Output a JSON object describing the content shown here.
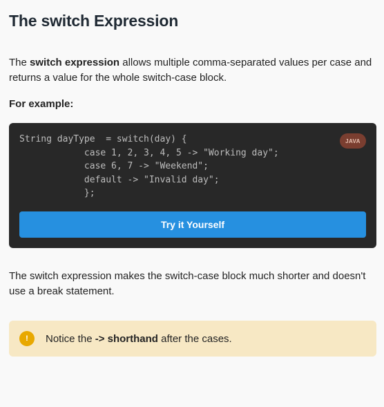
{
  "heading": {
    "title": "The switch Expression"
  },
  "intro": {
    "before": "The ",
    "bold": "switch expression",
    "after": " allows multiple comma-separated values per case and returns a value for the whole switch-case block."
  },
  "example": {
    "label": "For example:",
    "language_badge": "JAVA",
    "code_lines": [
      "String dayType  = switch(day) {",
      "            case 1, 2, 3, 4, 5 -> \"Working day\";",
      "            case 6, 7 -> \"Weekend\";",
      "            default -> \"Invalid day\";",
      "            };"
    ],
    "try_button_label": "Try it Yourself"
  },
  "outro": {
    "text": "The switch expression makes the switch-case block much shorter and doesn't use a break statement."
  },
  "note": {
    "icon": "warning-icon",
    "icon_glyph": "!",
    "before": "Notice the ",
    "bold": "-> shorthand",
    "after": " after the cases."
  },
  "colors": {
    "code_background": "#282828",
    "button": "#2690e0",
    "badge": "#7a3e30",
    "note_background": "#f7e8c4",
    "note_icon": "#e8a800"
  }
}
